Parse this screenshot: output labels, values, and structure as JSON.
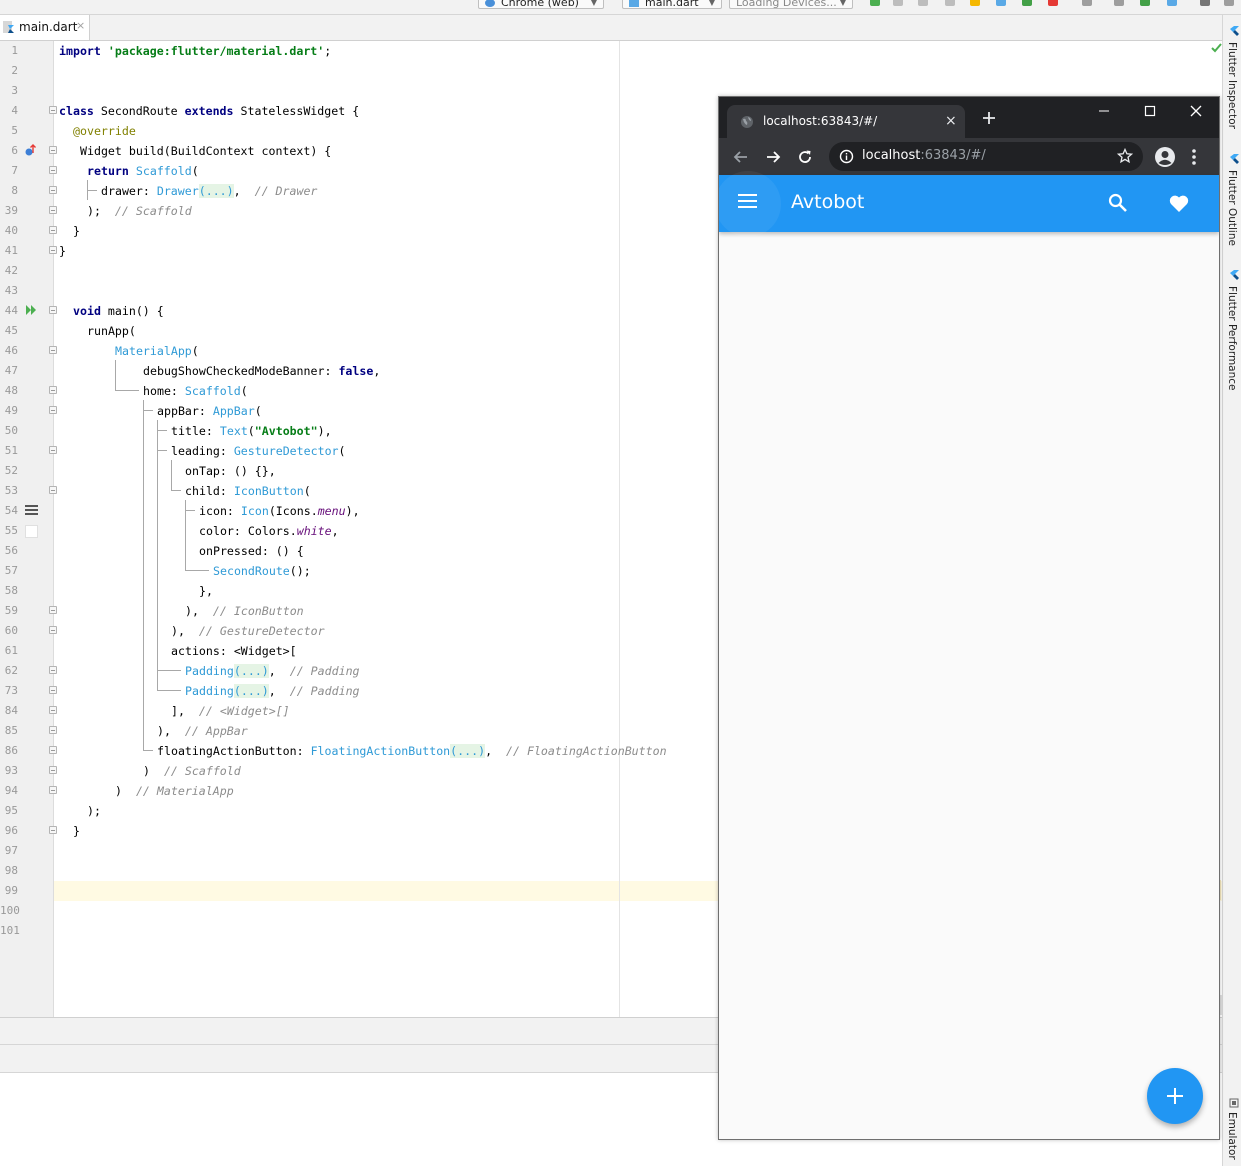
{
  "toolbar": {
    "device_combo": "Chrome (web)",
    "config_combo": "main.dart",
    "devices_combo": "Loading Devices..."
  },
  "editor_tab": {
    "file_name": "main.dart",
    "close_glyph": "×"
  },
  "line_numbers": [
    "1",
    "2",
    "3",
    "4",
    "5",
    "6",
    "7",
    "8",
    "39",
    "40",
    "41",
    "42",
    "43",
    "44",
    "45",
    "46",
    "47",
    "48",
    "49",
    "50",
    "51",
    "52",
    "53",
    "54",
    "55",
    "56",
    "57",
    "58",
    "59",
    "60",
    "61",
    "62",
    "73",
    "84",
    "85",
    "86",
    "93",
    "94",
    "95",
    "96",
    "97",
    "98",
    "99",
    "100",
    "101"
  ],
  "code": {
    "l1": {
      "kw": "import",
      "str": "'package:flutter/material.dart'",
      "end": ";"
    },
    "l4": {
      "kw1": "class",
      "name": " SecondRoute ",
      "kw2": "extends",
      "rest": " StatelessWidget {"
    },
    "l5": {
      "annotation": "@override"
    },
    "l6": {
      "text": "Widget build(BuildContext context) {"
    },
    "l7": {
      "kw": "return",
      "cls": "Scaffold",
      "rest": "("
    },
    "l8": {
      "prop": "drawer: ",
      "cls": "Drawer",
      "folded": "(...)",
      "rest": ",  ",
      "comment": "// Drawer"
    },
    "l39": {
      "rest": ");  ",
      "comment": "// Scaffold"
    },
    "l40": {
      "text": "}"
    },
    "l41": {
      "text": "}"
    },
    "l44": {
      "kw": "void",
      "rest": " main() {"
    },
    "l45": {
      "text": "runApp("
    },
    "l46": {
      "cls": "MaterialApp",
      "rest": "("
    },
    "l47": {
      "prop": "debugShowCheckedModeBanner: ",
      "kw": "false",
      "rest": ","
    },
    "l48": {
      "prop": "home: ",
      "cls": "Scaffold",
      "rest": "("
    },
    "l49": {
      "prop": "appBar: ",
      "cls": "AppBar",
      "rest": "("
    },
    "l50": {
      "prop": "title: ",
      "cls": "Text",
      "open": "(",
      "str": "\"Avtobot\"",
      "rest": "),"
    },
    "l51": {
      "prop": "leading: ",
      "cls": "GestureDetector",
      "rest": "("
    },
    "l52": {
      "text": "onTap: () {},"
    },
    "l53": {
      "prop": "child: ",
      "cls": "IconButton",
      "rest": "("
    },
    "l54": {
      "prop": "icon: ",
      "cls": "Icon",
      "open": "(Icons.",
      "ital": "menu",
      "rest": "),"
    },
    "l55": {
      "prop": "color: Colors.",
      "ital": "white",
      "rest": ","
    },
    "l56": {
      "text": "onPressed: () {"
    },
    "l57": {
      "cls": "SecondRoute",
      "rest": "();"
    },
    "l58": {
      "text": "},"
    },
    "l59": {
      "rest": "),  ",
      "comment": "// IconButton"
    },
    "l60": {
      "rest": "),  ",
      "comment": "// GestureDetector"
    },
    "l61": {
      "text": "actions: <Widget>["
    },
    "l62": {
      "cls": "Padding",
      "folded": "(...)",
      "rest": ",  ",
      "comment": "// Padding"
    },
    "l73": {
      "cls": "Padding",
      "folded": "(...)",
      "rest": ",  ",
      "comment": "// Padding"
    },
    "l84": {
      "rest": "],  ",
      "comment": "// <Widget>[]"
    },
    "l85": {
      "rest": "),  ",
      "comment": "// AppBar"
    },
    "l86": {
      "prop": "floatingActionButton: ",
      "cls": "FloatingActionButton",
      "folded": "(...)",
      "rest": ",  ",
      "comment": "// FloatingActionButton"
    },
    "l93": {
      "rest": ")  ",
      "comment": "// Scaffold"
    },
    "l94": {
      "rest": ")  ",
      "comment": "// MaterialApp"
    },
    "l95": {
      "text": ");"
    },
    "l96": {
      "text": "}"
    }
  },
  "side_tools": [
    "Flutter Inspector",
    "Flutter Outline",
    "Flutter Performance",
    "Emulator"
  ],
  "browser": {
    "tab_title": "localhost:63843/#/",
    "tab_close": "×",
    "url_host": "localhost",
    "url_rest": ":63843/#/",
    "app_title": "Avtobot"
  },
  "colors": {
    "app_bar": "#2196f3",
    "keyword": "#000080",
    "string": "#067d17",
    "class_ref": "#2f9ad6",
    "comment": "#8c8c8c",
    "chrome_dark": "#202124"
  },
  "icons": [
    "flutter-file-icon",
    "run-gutter-icon",
    "menu-icon",
    "search-icon",
    "heart-icon",
    "add-icon",
    "globe-icon",
    "back-arrow-icon",
    "forward-arrow-icon",
    "reload-icon",
    "info-icon",
    "star-icon",
    "profile-icon",
    "more-vert-icon",
    "minimize-icon",
    "maximize-icon",
    "close-icon",
    "check-icon"
  ]
}
